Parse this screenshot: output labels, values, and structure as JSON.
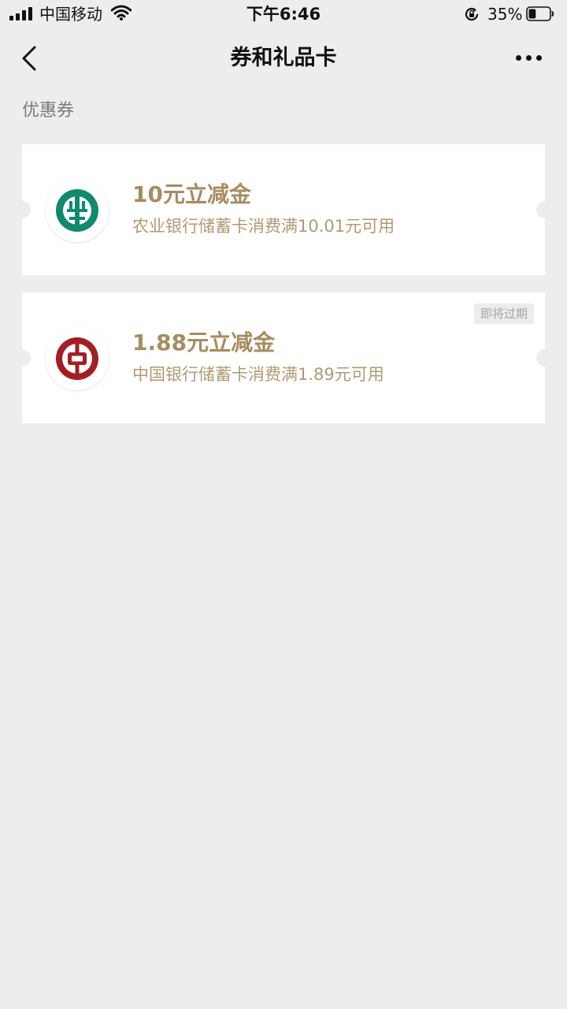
{
  "status_bar": {
    "carrier": "中国移动",
    "time": "下午6:46",
    "battery_percent": "35%",
    "battery_level": 0.35,
    "icons": [
      "signal-icon",
      "wifi-icon",
      "rotation-lock-icon",
      "battery-icon"
    ]
  },
  "nav": {
    "title": "券和礼品卡",
    "back_icon": "chevron-left-icon",
    "more_icon": "more-dots-icon"
  },
  "section": {
    "label": "优惠券"
  },
  "coupons": [
    {
      "title": "10元立减金",
      "description": "农业银行储蓄卡消费满10.01元可用",
      "bank_icon": "abc-bank-logo-icon",
      "logo_color": "#0f8a6d",
      "badge": ""
    },
    {
      "title": "1.88元立减金",
      "description": "中国银行储蓄卡消费满1.89元可用",
      "bank_icon": "boc-bank-logo-icon",
      "logo_color": "#a31e23",
      "badge": "即将过期"
    }
  ],
  "colors": {
    "background": "#ededed",
    "card": "#ffffff",
    "coupon_text": "#a68c5f"
  }
}
